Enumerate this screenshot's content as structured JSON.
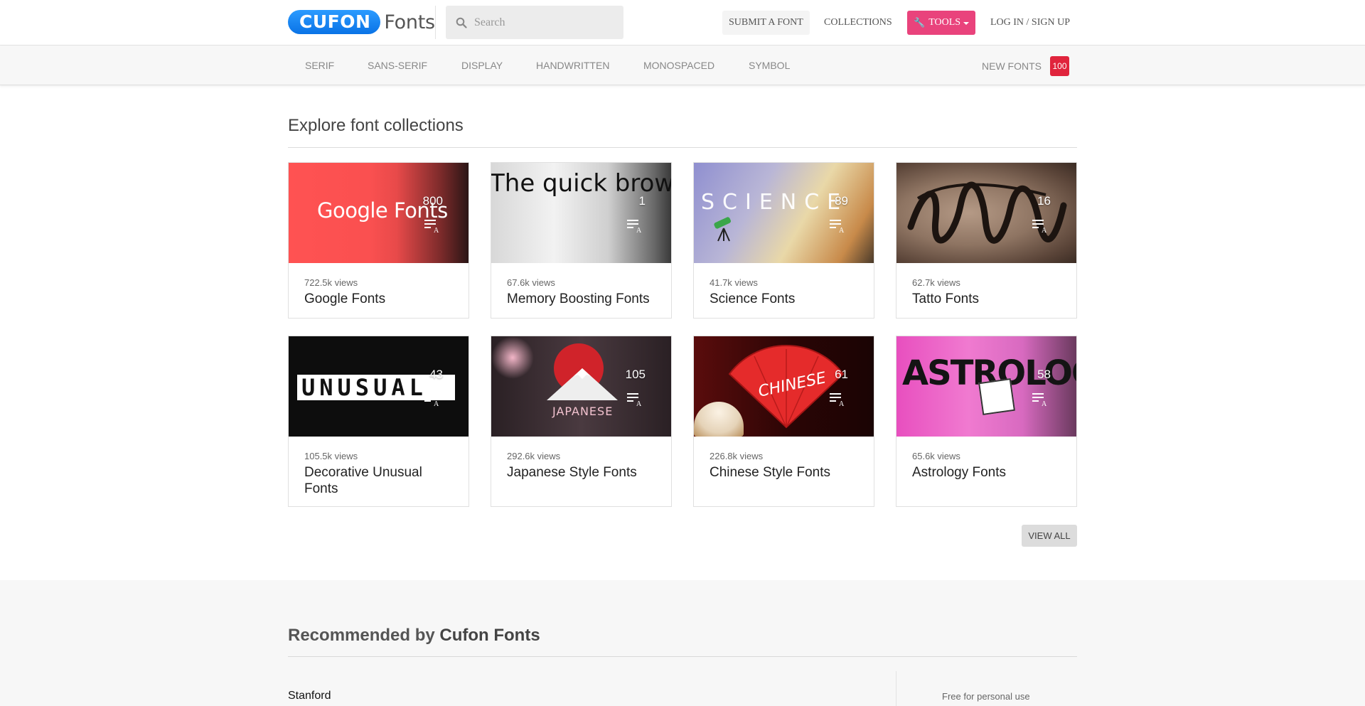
{
  "header": {
    "logo_badge": "CUFON",
    "logo_word": "Fonts",
    "search_placeholder": "Search",
    "submit_label": "SUBMIT A FONT",
    "collections_label": "COLLECTIONS",
    "tools_label": "TOOLS",
    "login_label": "LOG IN / SIGN UP"
  },
  "categories": {
    "serif": "SERIF",
    "sans_serif": "SANS-SERIF",
    "display": "DISPLAY",
    "handwritten": "HANDWRITTEN",
    "monospaced": "MONOSPACED",
    "symbol": "SYMBOL",
    "new_fonts": "NEW FONTS",
    "new_fonts_count": "100"
  },
  "collections": {
    "title": "Explore font collections",
    "view_all": "VIEW ALL",
    "cards": [
      {
        "name": "Google Fonts",
        "views": "722.5k views",
        "count": "800",
        "thumb_text": "Google Fonts"
      },
      {
        "name": "Memory Boosting Fonts",
        "views": "67.6k views",
        "count": "1",
        "thumb_text": "The quick brown"
      },
      {
        "name": "Science Fonts",
        "views": "41.7k views",
        "count": "89",
        "thumb_text": "SCIENCE"
      },
      {
        "name": "Tatto Fonts",
        "views": "62.7k views",
        "count": "16",
        "thumb_text": ""
      },
      {
        "name": "Decorative Unusual Fonts",
        "views": "105.5k views",
        "count": "43",
        "thumb_text": "UNUSUAL"
      },
      {
        "name": "Japanese Style Fonts",
        "views": "292.6k views",
        "count": "105",
        "thumb_text": "JAPANESE"
      },
      {
        "name": "Chinese Style Fonts",
        "views": "226.8k views",
        "count": "61",
        "thumb_text": "CHINESE"
      },
      {
        "name": "Astrology Fonts",
        "views": "65.6k views",
        "count": "58",
        "thumb_text": "ASTROLOGY"
      }
    ]
  },
  "recommended": {
    "title_bold": "Recommended by",
    "title_rest": "Cufon Fonts",
    "first_font": "Stanford",
    "license": "Free for personal use"
  },
  "colors": {
    "tools_button": "#e9437c",
    "badge": "#e0243c",
    "logo_blue": "#1a8cff"
  }
}
